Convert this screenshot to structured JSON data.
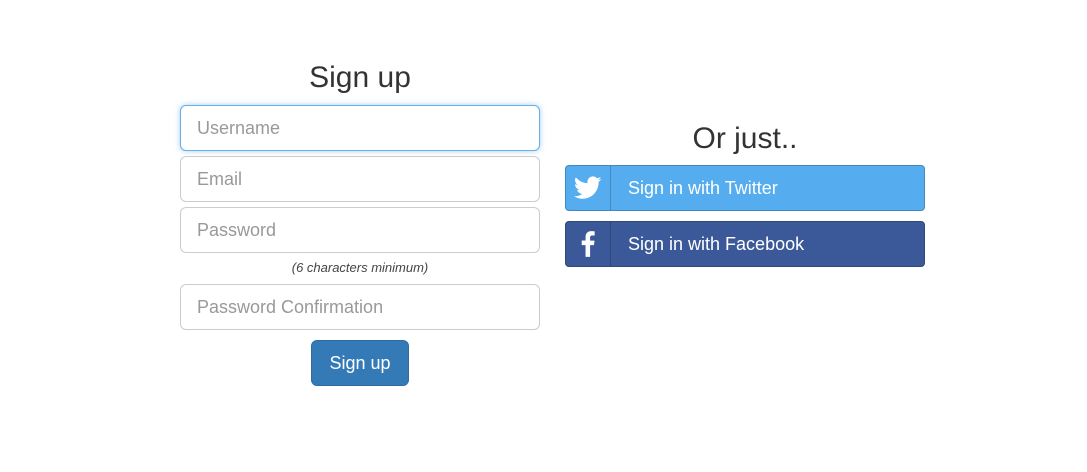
{
  "signup": {
    "title": "Sign up",
    "fields": {
      "username": {
        "placeholder": "Username",
        "value": ""
      },
      "email": {
        "placeholder": "Email",
        "value": ""
      },
      "password": {
        "placeholder": "Password",
        "value": ""
      },
      "password_hint": "(6 characters minimum)",
      "password_confirmation": {
        "placeholder": "Password Confirmation",
        "value": ""
      }
    },
    "submit_label": "Sign up",
    "submit_color": "#337ab7"
  },
  "social": {
    "title": "Or just..",
    "twitter": {
      "label": "Sign in with Twitter",
      "icon": "twitter-bird-icon",
      "color": "#55acee"
    },
    "facebook": {
      "label": "Sign in with Facebook",
      "icon": "facebook-f-icon",
      "color": "#3b5998"
    }
  }
}
